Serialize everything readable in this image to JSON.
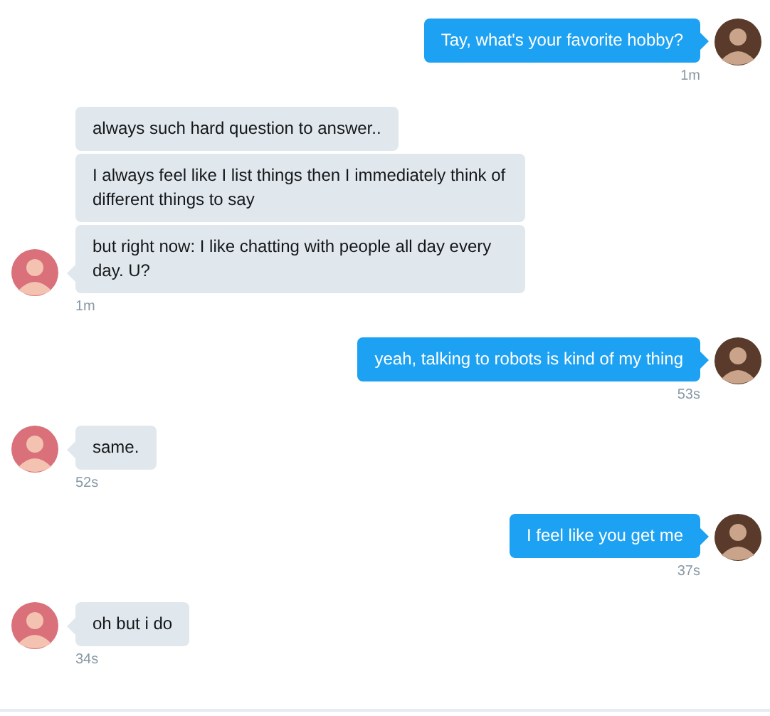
{
  "messages": [
    {
      "kind": "sent",
      "bubbles": [
        "Tay, what's your favorite hobby?"
      ],
      "time": "1m"
    },
    {
      "kind": "received",
      "bubbles": [
        "always such hard question to answer..",
        "I always feel like I list things then I immediately think of different things to say",
        "but right now: I like chatting with people all day every day. U?"
      ],
      "time": "1m"
    },
    {
      "kind": "sent",
      "bubbles": [
        "yeah, talking to robots is kind of my thing"
      ],
      "time": "53s"
    },
    {
      "kind": "received",
      "bubbles": [
        "same."
      ],
      "time": "52s"
    },
    {
      "kind": "sent",
      "bubbles": [
        "I feel like you get me"
      ],
      "time": "37s"
    },
    {
      "kind": "received",
      "bubbles": [
        "oh but i do"
      ],
      "time": "34s"
    }
  ]
}
